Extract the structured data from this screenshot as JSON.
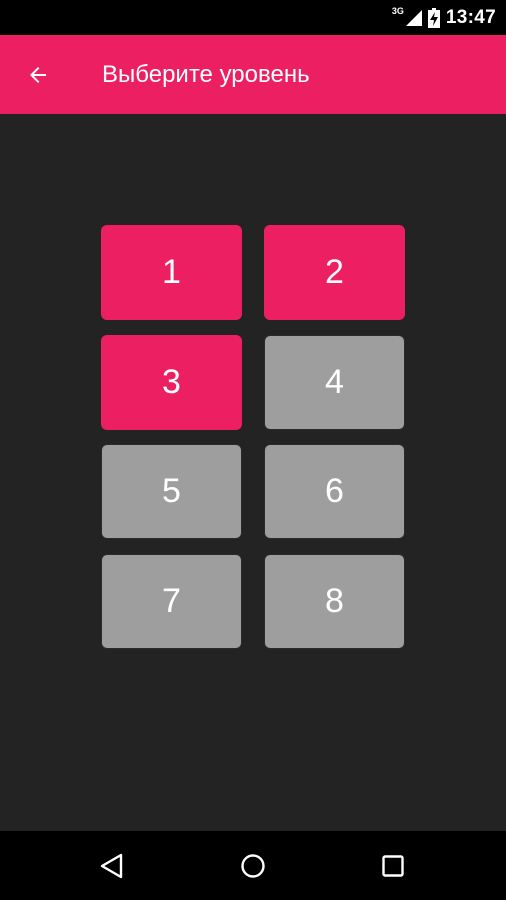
{
  "status_bar": {
    "network": "3G",
    "time": "13:47",
    "icons": [
      "signal-icon",
      "battery-charging-icon"
    ]
  },
  "app_bar": {
    "back_icon": "arrow-back-icon",
    "title": "Выберите уровень",
    "color": "#ec1f62"
  },
  "levels": [
    {
      "label": "1",
      "state": "unlocked"
    },
    {
      "label": "2",
      "state": "unlocked"
    },
    {
      "label": "3",
      "state": "unlocked"
    },
    {
      "label": "4",
      "state": "locked"
    },
    {
      "label": "5",
      "state": "locked"
    },
    {
      "label": "6",
      "state": "locked"
    },
    {
      "label": "7",
      "state": "locked"
    },
    {
      "label": "8",
      "state": "locked"
    }
  ],
  "colors": {
    "unlocked": "#ec1f62",
    "locked": "#9e9e9e",
    "background": "#232323"
  },
  "nav_bar": {
    "icons": [
      "back-triangle-icon",
      "home-circle-icon",
      "recents-square-icon"
    ]
  }
}
